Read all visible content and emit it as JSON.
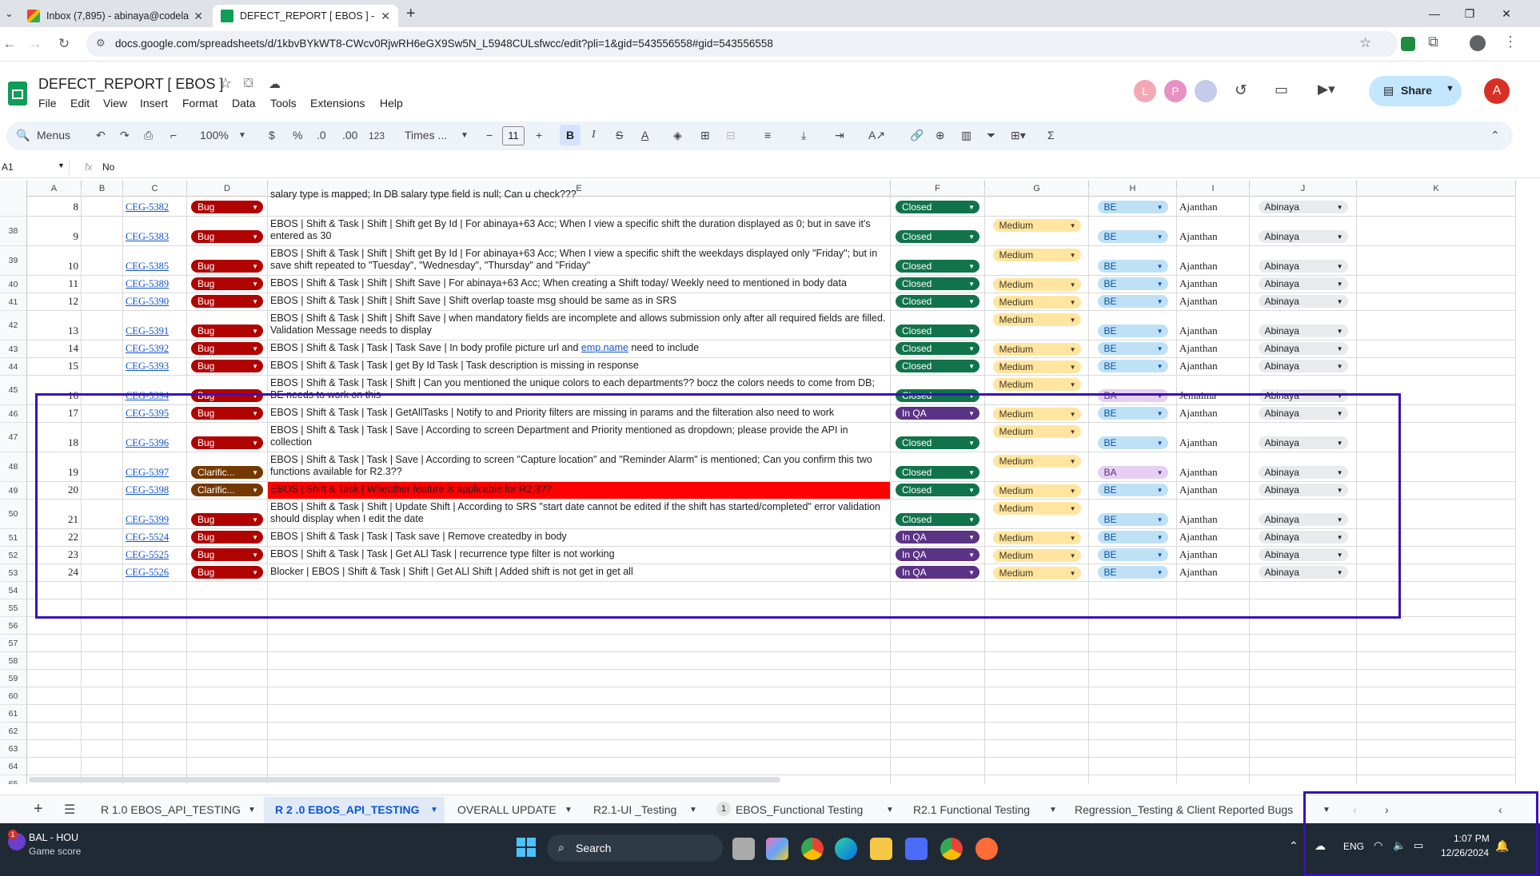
{
  "browser": {
    "tabs": [
      {
        "title": "Inbox (7,895) - abinaya@codela",
        "active": false
      },
      {
        "title": "DEFECT_REPORT [ EBOS ] - Goo",
        "active": true
      }
    ],
    "url": "docs.google.com/spreadsheets/d/1kbvBYkWT8-CWcv0RjwRH6eGX9Sw5N_L5948CULsfwcc/edit?pli=1&gid=543556558#gid=543556558"
  },
  "sheets": {
    "doc_title": "DEFECT_REPORT [ EBOS ]",
    "menu": [
      "File",
      "Edit",
      "View",
      "Insert",
      "Format",
      "Data",
      "Tools",
      "Extensions",
      "Help"
    ],
    "share_label": "Share",
    "avatars": [
      "L",
      "P",
      "A"
    ],
    "toolbar": {
      "menus_label": "Menus",
      "zoom": "100%",
      "currency": "$",
      "percent": "%",
      "dec_less": ".0",
      "dec_more": ".00",
      "format_123": "123",
      "font": "Times ...",
      "font_size": "11",
      "bold": "B",
      "italic": "I",
      "strike": "S",
      "text_color": "A"
    },
    "formula_bar": {
      "cell_ref": "A1",
      "fx": "fx",
      "value": "No"
    },
    "columns": [
      "A",
      "B",
      "C",
      "D",
      "E",
      "F",
      "G",
      "H",
      "I",
      "J",
      "K"
    ],
    "rows": [
      {
        "rownum": "",
        "no": "8",
        "id": "CEG-5382",
        "type": "Bug",
        "desc": "salary type is mapped; In DB salary type field is null; Can u check???",
        "status": "Closed",
        "priority": "",
        "team": "BE",
        "dev": "Ajanthan",
        "tester": "Abinaya"
      },
      {
        "rownum": "38",
        "no": "9",
        "id": "CEG-5383",
        "type": "Bug",
        "desc": "EBOS | Shift & Task | Shift | Shift get By Id | For abinaya+63 Acc; When I view a specific shift the duration displayed as 0; but in save it's entered as 30",
        "status": "Closed",
        "priority": "Medium",
        "team": "BE",
        "dev": "Ajanthan",
        "tester": "Abinaya"
      },
      {
        "rownum": "39",
        "no": "10",
        "id": "CEG-5385",
        "type": "Bug",
        "desc": "EBOS | Shift & Task | Shift | Shift get By Id | For abinaya+63 Acc; When I view a specific shift the weekdays displayed only \"Friday\"; but in save shift repeated to \"Tuesday\", \"Wednesday\", \"Thursday\" and \"Friday\"",
        "status": "Closed",
        "priority": "Medium",
        "team": "BE",
        "dev": "Ajanthan",
        "tester": "Abinaya"
      },
      {
        "rownum": "40",
        "no": "11",
        "id": "CEG-5389",
        "type": "Bug",
        "desc": "EBOS | Shift & Task | Shift | Shift Save | For abinaya+63 Acc; When creating a Shift today/ Weekly need to mentioned in body data",
        "status": "Closed",
        "priority": "Medium",
        "team": "BE",
        "dev": "Ajanthan",
        "tester": "Abinaya"
      },
      {
        "rownum": "41",
        "no": "12",
        "id": "CEG-5390",
        "type": "Bug",
        "desc": "EBOS | Shift & Task | Shift | Shift Save | Shift overlap toaste msg should be same as in SRS",
        "status": "Closed",
        "priority": "Medium",
        "team": "BE",
        "dev": "Ajanthan",
        "tester": "Abinaya"
      },
      {
        "rownum": "42",
        "no": "13",
        "id": "CEG-5391",
        "type": "Bug",
        "desc": "EBOS | Shift & Task | Shift | Shift Save | when mandatory fields are incomplete and allows submission only after all required fields are filled. Validation Message needs to display",
        "status": "Closed",
        "priority": "Medium",
        "team": "BE",
        "dev": "Ajanthan",
        "tester": "Abinaya"
      },
      {
        "rownum": "43",
        "no": "14",
        "id": "CEG-5392",
        "type": "Bug",
        "desc": "EBOS | Shift & Task | Task | Task Save | In body profile picture url and ",
        "desc_link": "emp.name",
        "desc_tail": " need to include",
        "status": "Closed",
        "priority": "Medium",
        "team": "BE",
        "dev": "Ajanthan",
        "tester": "Abinaya"
      },
      {
        "rownum": "44",
        "no": "15",
        "id": "CEG-5393",
        "type": "Bug",
        "desc": "EBOS | Shift & Task | Task | get By Id Task | Task description is missing in response",
        "status": "Closed",
        "priority": "Medium",
        "team": "BE",
        "dev": "Ajanthan",
        "tester": "Abinaya"
      },
      {
        "rownum": "45",
        "no": "16",
        "id": "CEG-5394",
        "type": "Bug",
        "desc": "EBOS | Shift & Task | Task | Shift | Can you mentioned the unique colors to each departments?? bocz the colors needs to come from DB; BE needs to work on this",
        "status": "Closed",
        "priority": "Medium",
        "team": "BA",
        "dev": "Jemaima",
        "tester": "Abinaya"
      },
      {
        "rownum": "46",
        "no": "17",
        "id": "CEG-5395",
        "type": "Bug",
        "desc": "EBOS | Shift & Task | Task | GetAllTasks | Notify to and Priority filters are missing in params and the filteration also need to work",
        "status": "In QA",
        "priority": "Medium",
        "team": "BE",
        "dev": "Ajanthan",
        "tester": "Abinaya"
      },
      {
        "rownum": "47",
        "no": "18",
        "id": "CEG-5396",
        "type": "Bug",
        "desc": "EBOS | Shift & Task | Task | Save | According to screen Department and Priority mentioned as dropdown; please provide the API in collection",
        "status": "Closed",
        "priority": "Medium",
        "team": "BE",
        "dev": "Ajanthan",
        "tester": "Abinaya"
      },
      {
        "rownum": "48",
        "no": "19",
        "id": "CEG-5397",
        "type": "Clarific...",
        "desc": "EBOS | Shift & Task | Task | Save | According to screen \"Capture location\" and \"Reminder Alarm\" is mentioned; Can you confirm this two functions available for R2.3??",
        "status": "Closed",
        "priority": "Medium",
        "team": "BA",
        "dev": "Ajanthan",
        "tester": "Abinaya"
      },
      {
        "rownum": "49",
        "no": "20",
        "id": "CEG-5398",
        "type": "Clarific...",
        "desc": "EBOS | Shift & Task | Wheather feature is applicable for R2.3??",
        "status": "Closed",
        "priority": "Medium",
        "team": "BE",
        "dev": "Ajanthan",
        "tester": "Abinaya",
        "red": true
      },
      {
        "rownum": "50",
        "no": "21",
        "id": "CEG-5399",
        "type": "Bug",
        "desc": "EBOS | Shift & Task | Shift | Update Shift | According to SRS \"start date cannot be edited if the shift has started/completed\" error validation should display when I edit the date",
        "status": "Closed",
        "priority": "Medium",
        "team": "BE",
        "dev": "Ajanthan",
        "tester": "Abinaya"
      },
      {
        "rownum": "51",
        "no": "22",
        "id": "CEG-5524",
        "type": "Bug",
        "desc": "EBOS | Shift & Task | Task | Task save | Remove createdby in body",
        "status": "In QA",
        "priority": "Medium",
        "team": "BE",
        "dev": "Ajanthan",
        "tester": "Abinaya"
      },
      {
        "rownum": "52",
        "no": "23",
        "id": "CEG-5525",
        "type": "Bug",
        "desc": "EBOS | Shift & Task | Task | Get ALl Task | recurrence type filter is not working",
        "status": "In QA",
        "priority": "Medium",
        "team": "BE",
        "dev": "Ajanthan",
        "tester": "Abinaya"
      },
      {
        "rownum": "53",
        "no": "24",
        "id": "CEG-5526",
        "type": "Bug",
        "desc": "Blocker | EBOS | Shift & Task | Shift | Get ALl Shift | Added shift is not get in get all",
        "status": "In QA",
        "priority": "Medium",
        "team": "BE",
        "dev": "Ajanthan",
        "tester": "Abinaya"
      }
    ],
    "empty_rows": [
      "54",
      "55",
      "56",
      "57",
      "58",
      "59",
      "60",
      "61",
      "62",
      "63",
      "64",
      "65"
    ],
    "sheet_tabs": [
      {
        "label": "R 1.0 EBOS_API_TESTING",
        "active": false
      },
      {
        "label": "R 2 .0 EBOS_API_TESTING",
        "active": true
      },
      {
        "label": "OVERALL UPDATE",
        "active": false
      },
      {
        "label": "R2.1-UI _Testing",
        "active": false
      },
      {
        "label": "EBOS_Functional Testing",
        "active": false,
        "badge": "1"
      },
      {
        "label": "R2.1 Functional Testing",
        "active": false
      },
      {
        "label": "Regression_Testing & Client Reported Bugs",
        "active": false
      }
    ]
  },
  "taskbar": {
    "weather_title": "BAL - HOU",
    "weather_sub": "Game score",
    "weather_badge": "1",
    "search": "Search",
    "lang": "ENG",
    "time": "1:07 PM",
    "date": "12/26/2024"
  },
  "colors": {
    "highlight": "#3b10b8",
    "bug": "#b10202",
    "closed": "#11734b",
    "inqa": "#5a3286"
  }
}
